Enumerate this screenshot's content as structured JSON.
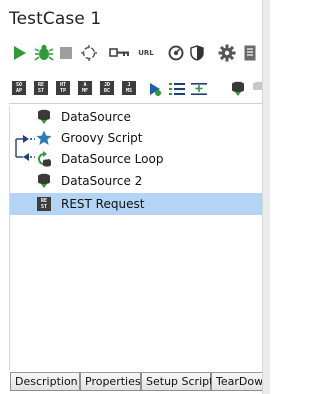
{
  "title": "TestCase 1",
  "toolbar": {
    "url_label": "URL",
    "icons": [
      "run-icon",
      "debug-icon",
      "stop-icon",
      "loop-icon",
      "key-icon",
      "url-icon",
      "gauge-icon",
      "shield-icon",
      "gear-icon",
      "document-icon"
    ]
  },
  "step_toolbar": {
    "badges": [
      {
        "line1": "SO",
        "line2": "AP"
      },
      {
        "line1": "RE",
        "line2": "ST"
      },
      {
        "line1": "HT",
        "line2": "TP"
      },
      {
        "line1": "A",
        "line2": "MF"
      },
      {
        "line1": "JD",
        "line2": "BC"
      },
      {
        "line1": "J",
        "line2": "MS"
      }
    ]
  },
  "tree": {
    "items": [
      {
        "label": "DataSource",
        "icon": "datasource-icon"
      },
      {
        "label": "Groovy Script",
        "icon": "groovy-star-icon"
      },
      {
        "label": "DataSource Loop",
        "icon": "datasource-loop-icon"
      },
      {
        "label": "DataSource 2",
        "icon": "datasource-icon"
      },
      {
        "label": "REST Request",
        "icon": "rest-request-icon",
        "selected": true,
        "badge": {
          "line1": "RE",
          "line2": "ST"
        }
      }
    ]
  },
  "tabs": [
    "Description",
    "Properties",
    "Setup Script",
    "TearDown Script"
  ],
  "colors": {
    "accent_green": "#2e9a3a",
    "selection": "#b3d4f4",
    "groovy_blue": "#2c7bb6",
    "arrow_navy": "#1f3f7a"
  }
}
